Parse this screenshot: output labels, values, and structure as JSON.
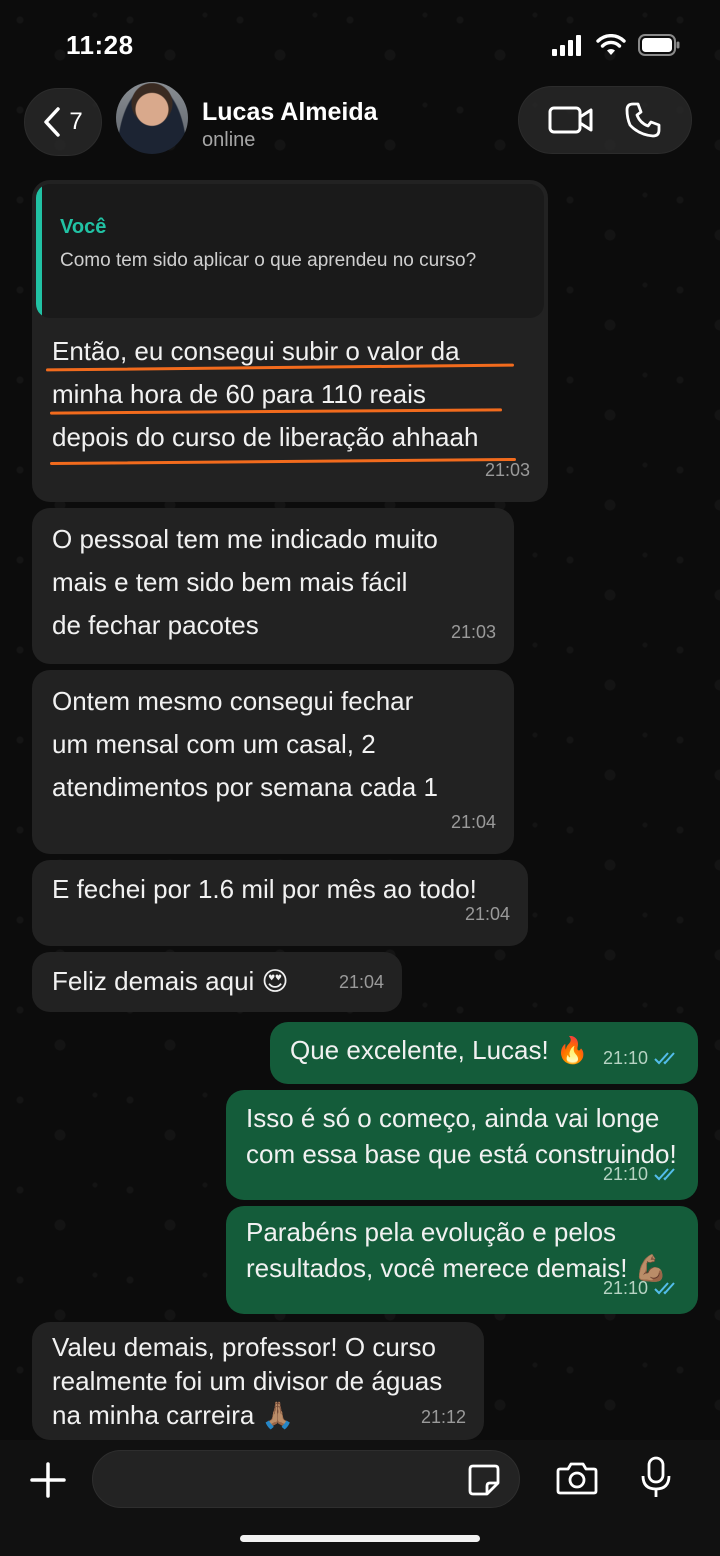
{
  "status_bar": {
    "time": "11:28"
  },
  "header": {
    "back_count": "7",
    "contact_name": "Lucas Almeida",
    "contact_status": "online"
  },
  "messages": [
    {
      "direction": "in",
      "quote_author": "Você",
      "quote_text": "Como tem sido aplicar o que aprendeu no curso?",
      "lines": [
        "Então, eu consegui subir o valor da",
        "minha hora de 60 para 110 reais",
        "depois do curso de liberação ahhaah"
      ],
      "time": "21:03"
    },
    {
      "direction": "in",
      "lines": [
        "O pessoal tem me indicado muito",
        "mais e tem sido bem mais fácil",
        "de fechar pacotes"
      ],
      "time": "21:03"
    },
    {
      "direction": "in",
      "lines": [
        "Ontem mesmo consegui fechar",
        "um mensal com um casal, 2",
        "atendimentos por semana cada 1"
      ],
      "time": "21:04"
    },
    {
      "direction": "in",
      "lines": [
        "E fechei por 1.6 mil por mês ao todo!"
      ],
      "time": "21:04"
    },
    {
      "direction": "in",
      "lines": [
        "Feliz demais aqui 😍"
      ],
      "time": "21:04"
    },
    {
      "direction": "out",
      "lines": [
        "Que excelente, Lucas! 🔥"
      ],
      "time": "21:10"
    },
    {
      "direction": "out",
      "lines": [
        "Isso é só o começo, ainda vai longe",
        "com essa base que está construindo!"
      ],
      "time": "21:10"
    },
    {
      "direction": "out",
      "lines": [
        "Parabéns pela evolução e pelos",
        "resultados, você merece demais! 💪🏽"
      ],
      "time": "21:10"
    },
    {
      "direction": "in",
      "lines": [
        "Valeu demais, professor! O curso",
        "realmente foi um divisor de águas",
        "na minha carreira 🙏🏽"
      ],
      "time": "21:12"
    }
  ],
  "colors": {
    "incoming_bubble": "#222222",
    "outgoing_bubble": "#145c3a",
    "quote_accent": "#21c2a4",
    "underline_highlight": "#f26b1d",
    "read_ticks": "#53bdeb"
  },
  "icons": {
    "back": "chevron-left-icon",
    "video": "video-camera-icon",
    "call": "phone-icon",
    "attach": "plus-icon",
    "sticker": "sticker-icon",
    "camera": "camera-icon",
    "mic": "microphone-icon"
  }
}
